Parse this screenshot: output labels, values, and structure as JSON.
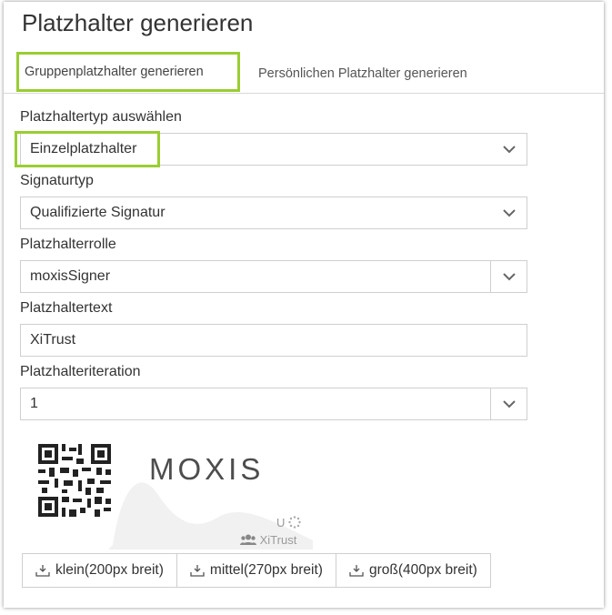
{
  "title": "Platzhalter generieren",
  "tabs": [
    {
      "label": "Gruppenplatzhalter generieren",
      "active": true
    },
    {
      "label": "Persönlichen Platzhalter generieren",
      "active": false
    }
  ],
  "form": {
    "placeholder_type": {
      "label": "Platzhaltertyp auswählen",
      "value": "Einzelplatzhalter"
    },
    "signature_type": {
      "label": "Signaturtyp",
      "value": "Qualifizierte Signatur"
    },
    "placeholder_role": {
      "label": "Platzhalterrolle",
      "value": "moxisSigner"
    },
    "placeholder_text": {
      "label": "Platzhaltertext",
      "value": "XiTrust"
    },
    "placeholder_iteration": {
      "label": "Platzhalteriteration",
      "value": "1"
    }
  },
  "preview": {
    "logo": "MOXIS",
    "role_initial": "U",
    "group_name": "XiTrust"
  },
  "download_buttons": [
    {
      "label": "klein(200px breit)",
      "icon": "download-icon"
    },
    {
      "label": "mittel(270px breit)",
      "icon": "download-icon"
    },
    {
      "label": "groß(400px breit)",
      "icon": "download-icon"
    }
  ],
  "colors": {
    "highlight": "#9acd32",
    "border": "#cfcfcf"
  }
}
